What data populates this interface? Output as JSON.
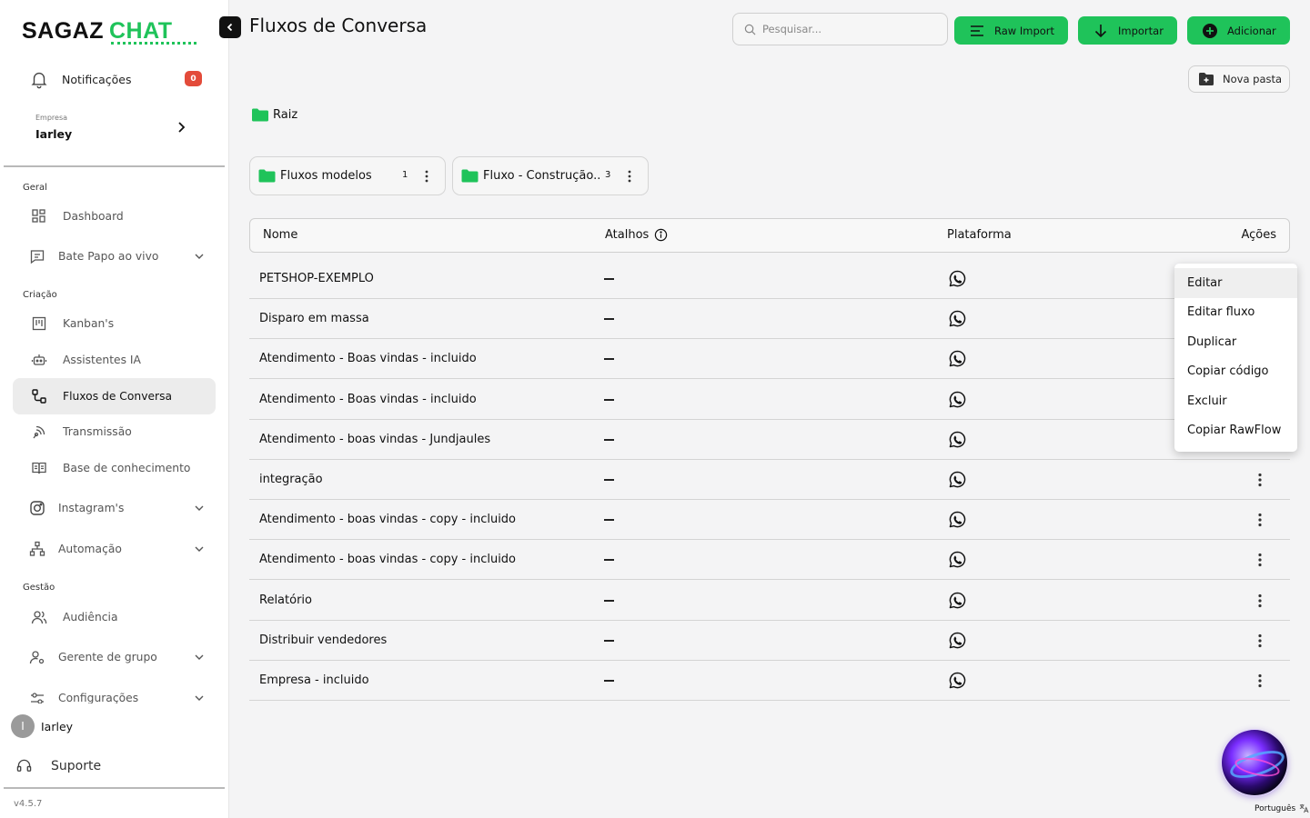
{
  "brand": {
    "part1": "SAGAZ",
    "part2": "CHAT",
    "accent": "#1fc35a"
  },
  "sidebar": {
    "notifications": {
      "label": "Notificações",
      "count": "0"
    },
    "company": {
      "caption": "Empresa",
      "name": "Iarley"
    },
    "groups": {
      "general": "Geral",
      "creation": "Criação",
      "management": "Gestão"
    },
    "items": {
      "dashboard": "Dashboard",
      "live_chat": "Bate Papo ao vivo",
      "kanban": "Kanban's",
      "ai_assistants": "Assistentes IA",
      "flows": "Fluxos de Conversa",
      "broadcast": "Transmissão",
      "knowledge_base": "Base de conhecimento",
      "instagram": "Instagram's",
      "automation": "Automação",
      "audience": "Audiência",
      "group_manager": "Gerente de grupo",
      "settings": "Configurações"
    },
    "user": {
      "initial": "I",
      "name": "Iarley"
    },
    "support": "Suporte",
    "version": "v4.5.7"
  },
  "header": {
    "title": "Fluxos de Conversa",
    "search_placeholder": "Pesquisar...",
    "raw_import": "Raw Import",
    "import": "Importar",
    "add": "Adicionar",
    "new_folder": "Nova pasta"
  },
  "breadcrumb": {
    "root": "Raiz"
  },
  "folders": [
    {
      "name": "Fluxos modelos",
      "count": "1"
    },
    {
      "name": "Fluxo - Construção..",
      "count": "3"
    }
  ],
  "table": {
    "columns": {
      "name": "Nome",
      "shortcuts": "Atalhos",
      "platform": "Plataforma",
      "actions": "Ações"
    },
    "shortcut_empty": "—",
    "platform_icon": "whatsapp-icon",
    "rows": [
      "PETSHOP-EXEMPLO",
      "Disparo em massa",
      "Atendimento - Boas vindas - incluido",
      "Atendimento - Boas vindas - incluido",
      "Atendimento - boas vindas - Jundjaules",
      "integração",
      "Atendimento - boas vindas - copy - incluido",
      "Atendimento - boas vindas - copy - incluido",
      "Relatório",
      "Distribuir vendedores",
      "Empresa - incluido"
    ]
  },
  "actions_menu": [
    "Editar",
    "Editar fluxo",
    "Duplicar",
    "Copiar código",
    "Excluir",
    "Copiar RawFlow"
  ],
  "language": "Português"
}
